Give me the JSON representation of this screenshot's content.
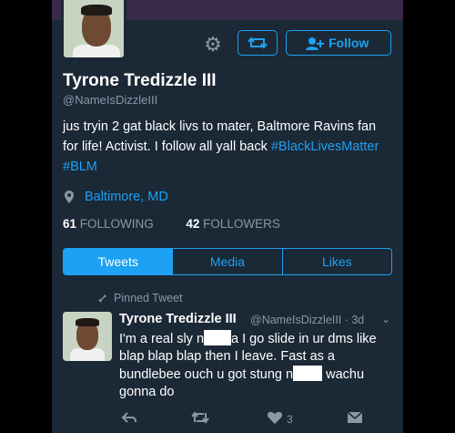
{
  "profile": {
    "name": "Tyrone Tredizzle III",
    "handle": "@NameIsDizzleIII",
    "bio_text": "jus tryin 2 gat black livs to mater, Baltmore Ravins fan for life! Activist. I follow all yall back ",
    "bio_hashtags": "#BlackLivesMatter #BLM",
    "location": "Baltimore, MD",
    "following_count": "61",
    "following_label": "FOLLOWING",
    "followers_count": "42",
    "followers_label": "FOLLOWERS"
  },
  "actions": {
    "follow_label": "Follow"
  },
  "tabs": [
    {
      "label": "Tweets",
      "active": true
    },
    {
      "label": "Media",
      "active": false
    },
    {
      "label": "Likes",
      "active": false
    }
  ],
  "pinned_tweet": {
    "pinned_label": "Pinned Tweet",
    "author_name": "Tyrone Tredizzle III",
    "author_handle_time": "@NameIsDizzleIII · 3d",
    "text_part1": "I'm a real sly n",
    "text_part2": "a I go slide in ur dms like blap blap blap then I leave. Fast as a bundlebee ouch u got stung n",
    "text_part3": " wachu gonna do",
    "like_count": "3"
  },
  "icons": [
    "gear-icon",
    "retweet-icon",
    "add-user-icon",
    "location-pin-icon",
    "pin-icon",
    "reply-icon",
    "retweet-icon",
    "heart-icon",
    "dm-icon",
    "chevron-down-icon"
  ],
  "colors": {
    "background": "#1b2836",
    "accent": "#1da1f2",
    "muted": "#8899a6"
  }
}
